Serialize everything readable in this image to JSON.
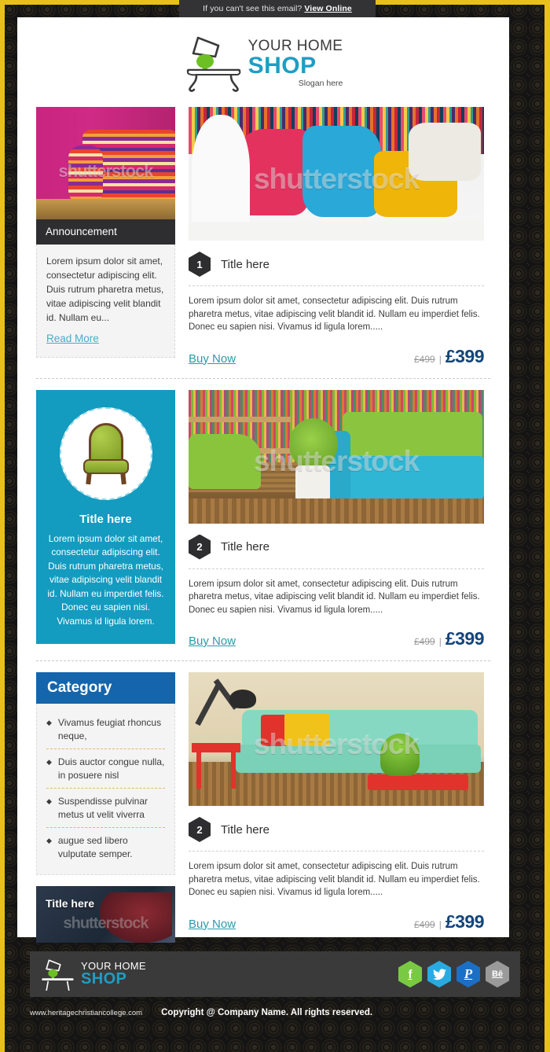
{
  "preheader": {
    "text": "If you can't see this email?",
    "link_label": "View Online"
  },
  "header": {
    "logo_line1": "YOUR HOME",
    "logo_line2": "SHOP",
    "slogan": "Slogan here",
    "logo_icon": "table-lamp-icon"
  },
  "colors": {
    "brand_blue": "#1f9dc4",
    "teal_box": "#149bc0",
    "category_blue": "#1465ab",
    "price_blue": "#13457a",
    "buy_teal": "#2a9aaa",
    "border_yellow": "#e8c01e",
    "dark_bar": "#2e2e30",
    "footer_gray": "#3a3a3a"
  },
  "announcement": {
    "bar_title": "Announcement",
    "body": "Lorem ipsum dolor sit amet, consectetur adipiscing elit. Duis rutrum pharetra metus, vitae adipiscing velit blandit id. Nullam eu...",
    "read_more": "Read More",
    "image_alt": "striped-sofa-pink-wall-photo",
    "watermark": "shutterstock"
  },
  "feature_box": {
    "title": "Title here",
    "body": "Lorem ipsum dolor sit amet, consectetur adipiscing elit. Duis rutrum pharetra metus, vitae adipiscing velit blandit id. Nullam eu imperdiet felis. Donec eu sapien nisi. Vivamus id ligula lorem.",
    "image_alt": "green-tufted-armchair-photo",
    "watermark": "shutterstock"
  },
  "category": {
    "heading": "Category",
    "items": [
      "Vivamus feugiat rhoncus neque,",
      "Duis auctor congue nulla, in posuere nisl",
      "Suspendisse pulvinar metus ut velit viverra",
      "augue sed libero vulputate semper."
    ]
  },
  "title_banner": {
    "label": "Title here",
    "image_alt": "woman-in-red-dress-photo",
    "watermark": "shutterstock"
  },
  "products": [
    {
      "number": "1",
      "title": "Title here",
      "body": "Lorem ipsum dolor sit amet, consectetur adipiscing elit. Duis rutrum pharetra metus, vitae adipiscing velit blandit id. Nullam eu imperdiet felis. Donec eu sapien nisi. Vivamus id ligula lorem.....",
      "buy_label": "Buy Now",
      "old_price": "£499",
      "separator": "|",
      "new_price": "£399",
      "image_alt": "colorful-cushions-photo",
      "watermark": "shutterstock"
    },
    {
      "number": "2",
      "title": "Title here",
      "body": "Lorem ipsum dolor sit amet, consectetur adipiscing elit. Duis rutrum pharetra metus, vitae adipiscing velit blandit id. Nullam eu imperdiet felis. Donec eu sapien nisi. Vivamus id ligula lorem.....",
      "buy_label": "Buy Now",
      "old_price": "£499",
      "separator": "|",
      "new_price": "£399",
      "image_alt": "green-blue-living-room-photo",
      "watermark": "shutterstock"
    },
    {
      "number": "2",
      "title": "Title here",
      "body": "Lorem ipsum dolor sit amet, consectetur adipiscing elit. Duis rutrum pharetra metus, vitae adipiscing velit blandit id. Nullam eu imperdiet felis. Donec eu sapien nisi. Vivamus id ligula lorem.....",
      "buy_label": "Buy Now",
      "old_price": "£499",
      "separator": "|",
      "new_price": "£399",
      "image_alt": "mint-sofa-red-table-photo",
      "watermark": "shutterstock"
    }
  ],
  "footer": {
    "logo_line1": "YOUR HOME",
    "logo_line2": "SHOP",
    "socials": [
      {
        "name": "facebook-icon",
        "glyph": "f",
        "color": "#7ac943"
      },
      {
        "name": "twitter-icon",
        "glyph": "ᵗ",
        "color": "#29abe2"
      },
      {
        "name": "pinterest-icon",
        "glyph": "р",
        "color": "#1b6fc4"
      },
      {
        "name": "behance-icon",
        "glyph": "Bē",
        "color": "#9a9a9a"
      }
    ],
    "url": "www.heritagechristiancollege.com",
    "copyright": "Copyright @ Company Name. All rights reserved."
  }
}
